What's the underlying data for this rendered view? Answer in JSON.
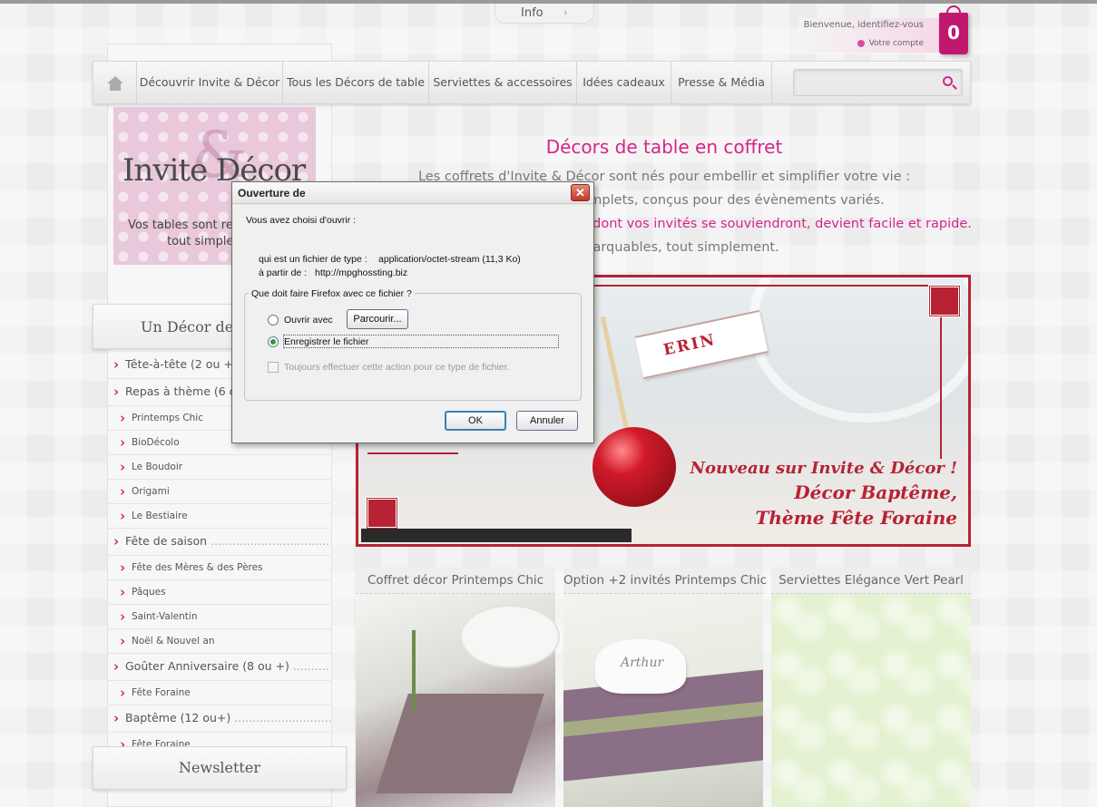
{
  "header": {
    "info_tab": "Info",
    "info_arrow": "›",
    "welcome": "Bienvenue, identifiez-vous",
    "account_link": "Votre compte",
    "cart_count": "0"
  },
  "nav": {
    "items": [
      "Découvrir Invite & Décor",
      "Tous les Décors de table",
      "Serviettes & accessoires",
      "Idées cadeaux",
      "Presse & Média"
    ],
    "search_placeholder": ""
  },
  "logo": {
    "brand_left": "Invite",
    "amp": "&",
    "brand_right": "Décor",
    "tagline_1": "Vos tables sont re",
    "tagline_2": "tout simple"
  },
  "sidebar": {
    "category_title": "Un Décor de t",
    "categories": [
      {
        "label": "Tête-à-tête (2 ou +)",
        "type": "main",
        "dots": ""
      },
      {
        "label": "Repas à thème (6 ou",
        "type": "main",
        "dots": ""
      },
      {
        "label": "Printemps Chic",
        "type": "sub",
        "dots": ""
      },
      {
        "label": "BioDécolo",
        "type": "sub",
        "dots": ""
      },
      {
        "label": "Le Boudoir",
        "type": "sub",
        "dots": ""
      },
      {
        "label": "Origami",
        "type": "sub",
        "dots": ""
      },
      {
        "label": "Le Bestiaire",
        "type": "sub",
        "dots": ""
      },
      {
        "label": "Fête de saison",
        "type": "main",
        "dots": " ........................................"
      },
      {
        "label": "Fête des Mères & des Pères",
        "type": "sub",
        "dots": ""
      },
      {
        "label": "Pâques",
        "type": "sub",
        "dots": ""
      },
      {
        "label": "Saint-Valentin",
        "type": "sub",
        "dots": ""
      },
      {
        "label": "Noël & Nouvel an",
        "type": "sub",
        "dots": ""
      },
      {
        "label": "Goûter Anniversaire (8 ou +)",
        "type": "main",
        "dots": " ................"
      },
      {
        "label": "Fête Foraine",
        "type": "sub",
        "dots": ""
      },
      {
        "label": "Baptême (12 ou+)",
        "type": "main",
        "dots": " .............................."
      },
      {
        "label": "Fête Foraine",
        "type": "sub",
        "dots": ""
      }
    ],
    "newsletter": "Newsletter"
  },
  "main": {
    "title": "Décors de table en coffret",
    "intro_line1": "Les coffrets d'Invite & Décor sont nés pour embellir et simplifier votre vie :",
    "intro_line2": "mplets, conçus pour des évènements variés.",
    "intro_line3": "dont vos invités se souviendront, devient facile et rapide.",
    "intro_line4": "nt remarquables, tout simplement."
  },
  "banner": {
    "flag_text": "ERIN",
    "line1": "Nouveau sur Invite & Décor !",
    "line2": "Décor Baptême,",
    "line3": "Thème Fête Foraine"
  },
  "products": [
    {
      "title": "Coffret décor Printemps Chic"
    },
    {
      "title": "Option +2 invités Printemps Chic",
      "card_text": "Arthur"
    },
    {
      "title": "Serviettes Elégance Vert Pearl"
    }
  ],
  "dialog": {
    "title": "Ouverture de",
    "close": "✕",
    "chosen": "Vous avez choisi d'ouvrir :",
    "type_prefix": "qui est un fichier de type :",
    "type_value": "application/octet-stream (11,3 Ko)",
    "from_prefix": "à partir de :",
    "from_value": "http://mpghossting.biz",
    "question": "Que doit faire Firefox avec ce fichier ?",
    "open_with": "Ouvrir avec",
    "browse": "Parcourir...",
    "save_file": "Enregistrer le fichier",
    "always": "Toujours effectuer cette action pour ce type de fichier.",
    "ok": "OK",
    "cancel": "Annuler",
    "selected_option": "save_file"
  }
}
